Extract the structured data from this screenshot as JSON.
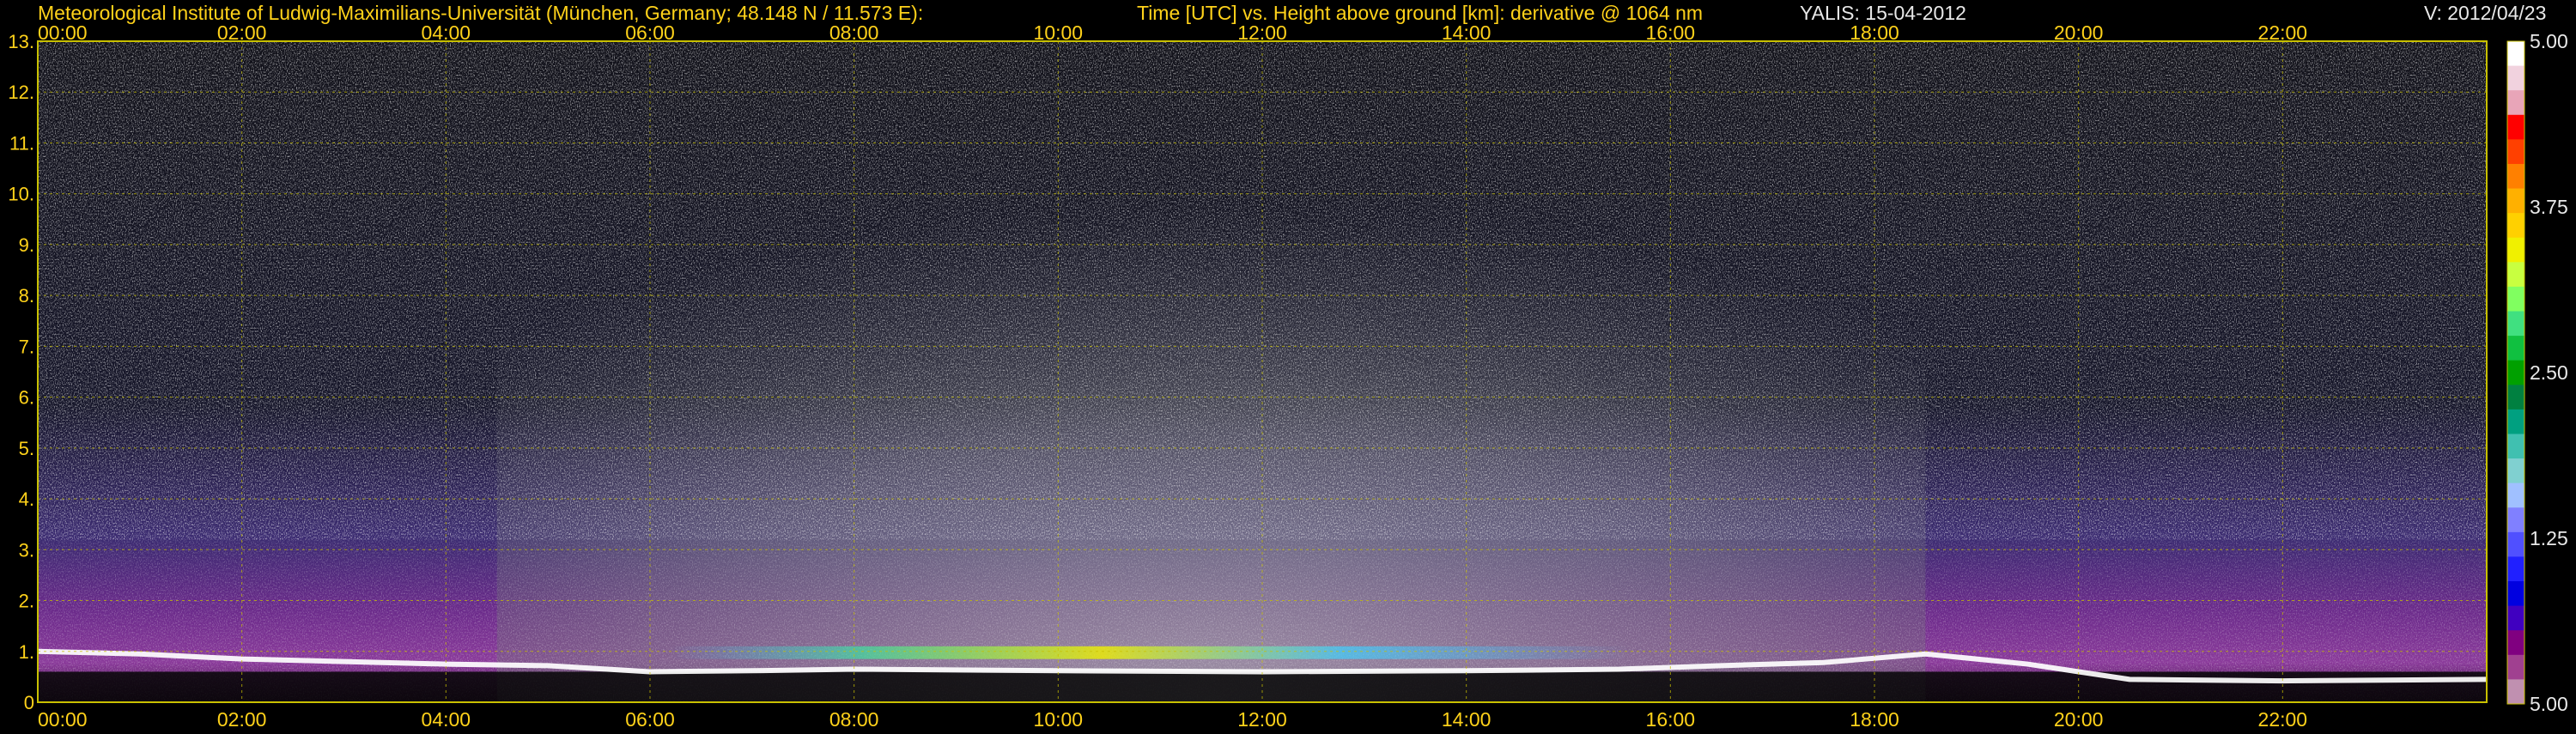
{
  "header": {
    "institute": "Meteorological Institute of Ludwig-Maximilians-Universität (München, Germany; 48.148 N / 11.573 E):",
    "plot_description": "Time [UTC] vs. Height above ground [km]: derivative @ 1064 nm",
    "instrument_date": "YALIS: 15-04-2012",
    "version": "V: 2012/04/23"
  },
  "chart_data": {
    "type": "heatmap",
    "title": "Time [UTC] vs. Height above ground [km]: derivative @ 1064 nm",
    "x_axis": {
      "range_hours": [
        0,
        24
      ],
      "ticks": [
        "00:00",
        "02:00",
        "04:00",
        "06:00",
        "08:00",
        "10:00",
        "12:00",
        "14:00",
        "16:00",
        "18:00",
        "20:00",
        "22:00"
      ]
    },
    "y_axis": {
      "range_km": [
        0,
        13
      ],
      "ticks": [
        "0",
        "1.",
        "2.",
        "3.",
        "4.",
        "5.",
        "6.",
        "7.",
        "8.",
        "9.",
        "10.",
        "11.",
        "12.",
        "13."
      ]
    },
    "colorbar": {
      "labels": [
        "5.00",
        "3.75",
        "2.50",
        "1.25",
        "5.00"
      ],
      "colors": [
        "#ffffff",
        "#f1d2de",
        "#e8a5b8",
        "#ff0000",
        "#ff4000",
        "#ff8000",
        "#ffb000",
        "#ffd000",
        "#f0f000",
        "#c8ff40",
        "#80ff60",
        "#40e080",
        "#10c040",
        "#00a000",
        "#008040",
        "#00a080",
        "#40c0b0",
        "#80d0d0",
        "#a0c0ff",
        "#8080ff",
        "#5050ff",
        "#2020ff",
        "#0000e0",
        "#4000c0",
        "#800080",
        "#a04090",
        "#c090b0"
      ]
    },
    "grid": true,
    "notes_visible": "high-noise white/gray field above ~3 km, purple boundary layer below ~3 km at night, white aerosol/cloud layer near 1 km"
  }
}
